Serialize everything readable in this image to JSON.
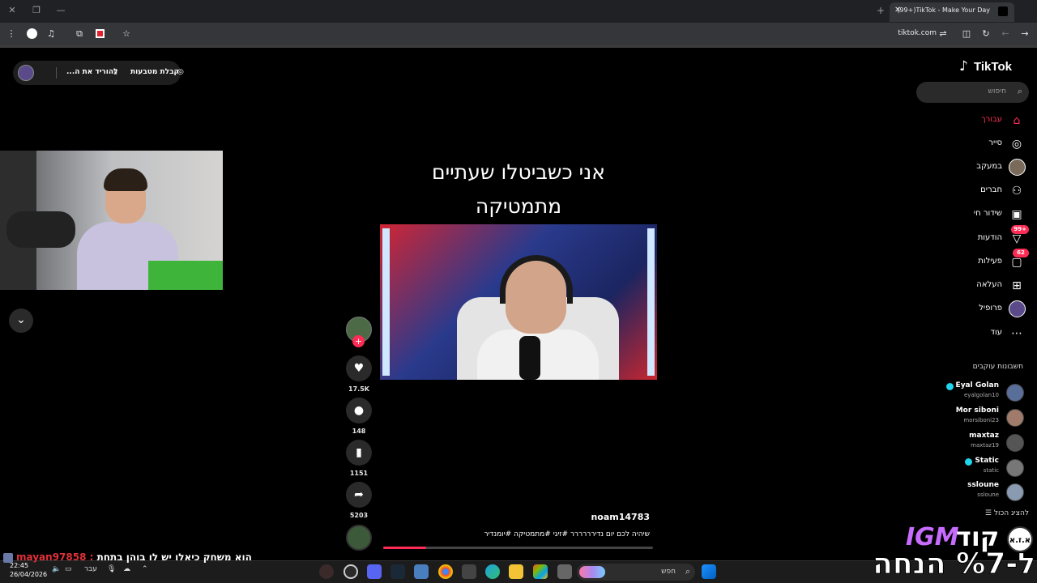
{
  "browser": {
    "tab_title": "(99+)TikTok - Make Your Day",
    "url": "tiktok.com"
  },
  "pill": {
    "earn_coins": "קבלת מטבעות",
    "download_app": "להוריד את ה..."
  },
  "video": {
    "caption_line1": "אני כשביטלו שעתיים",
    "caption_line2": "מתמטיקה",
    "username": "noam14783",
    "description": "שיהיה לכם יום נדירררררר #זיגי #מתמטיקה #יומנדיר",
    "progress": 0.16,
    "likes": "17.5K",
    "comments": "148",
    "saves": "1151",
    "shares": "5203"
  },
  "sidebar": {
    "logo": "TikTok",
    "search_placeholder": "חיפוש",
    "nav": [
      {
        "label": "עבורך",
        "icon": "home-icon",
        "active": true
      },
      {
        "label": "סייר",
        "icon": "compass-icon"
      },
      {
        "label": "במעקב",
        "icon": "avatar-icon"
      },
      {
        "label": "חברים",
        "icon": "friends-icon"
      },
      {
        "label": "שידור חי",
        "icon": "live-icon"
      },
      {
        "label": "הודעות",
        "icon": "messages-icon",
        "badge": "99+"
      },
      {
        "label": "פעילות",
        "icon": "activity-icon",
        "badge": "62"
      },
      {
        "label": "העלאה",
        "icon": "upload-icon"
      },
      {
        "label": "פרופיל",
        "icon": "profile-icon"
      },
      {
        "label": "עוד",
        "icon": "more-icon"
      }
    ],
    "following_title": "חשבונות עוקבים",
    "accounts": [
      {
        "name": "Eyal Golan",
        "handle": "eyalgolan10",
        "verified": true
      },
      {
        "name": "Mor siboni",
        "handle": "morsiboni23",
        "verified": false
      },
      {
        "name": "maxtaz",
        "handle": "maxtaz19",
        "verified": false
      },
      {
        "name": "Static",
        "handle": "static",
        "verified": true
      },
      {
        "name": "ssloune",
        "handle": "ssloune",
        "verified": false
      }
    ],
    "see_all": "להציג הכול"
  },
  "taskbar": {
    "time": "22:45",
    "date": "26/04/2026",
    "lang": "עבר",
    "search": "חפש"
  },
  "overlay": {
    "chat_user": "mayan97858 :",
    "chat_message": "הוא משחק כיאלו יש לו בוהן בתחת",
    "promo_logo": "א.ז.א",
    "promo_code": "קוד",
    "promo_brand": "IGM",
    "promo_line2": "ל-%7 הנחה"
  }
}
